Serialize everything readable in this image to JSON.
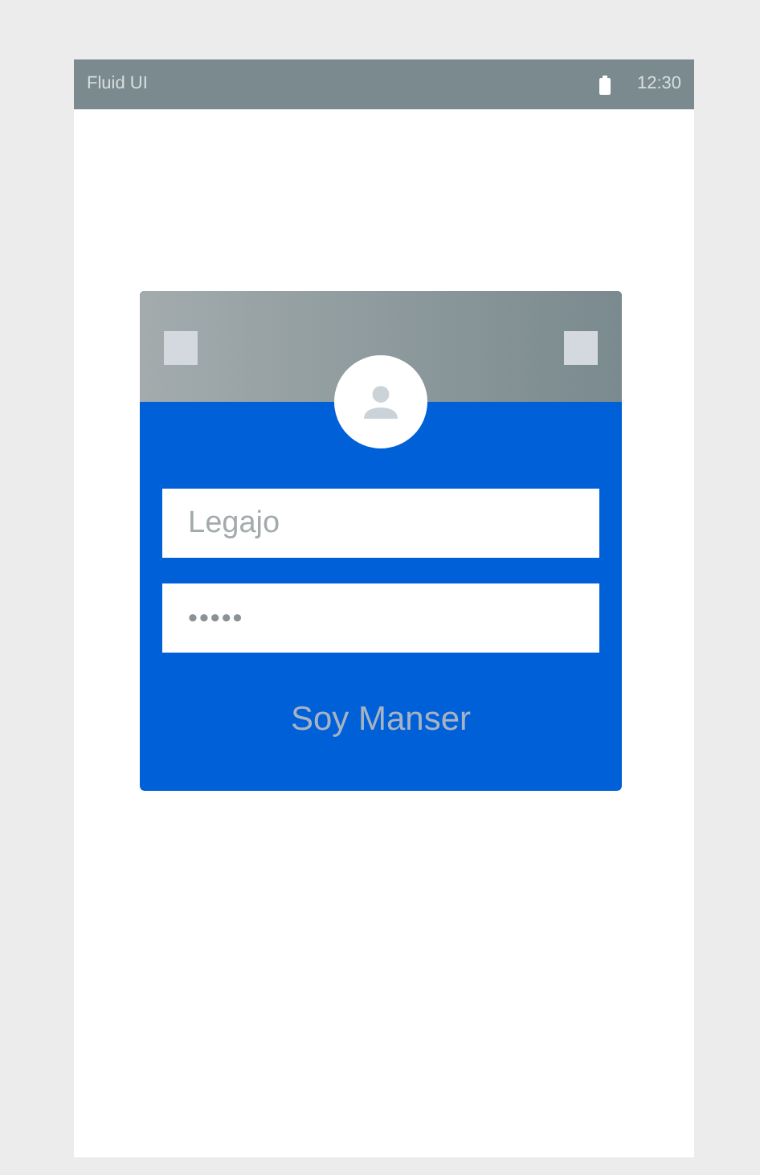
{
  "status_bar": {
    "title": "Fluid UI",
    "time": "12:30"
  },
  "login_card": {
    "username": {
      "placeholder": "Legajo"
    },
    "password": {
      "placeholder": "•••••"
    },
    "submit_button": "Soy Manser"
  }
}
